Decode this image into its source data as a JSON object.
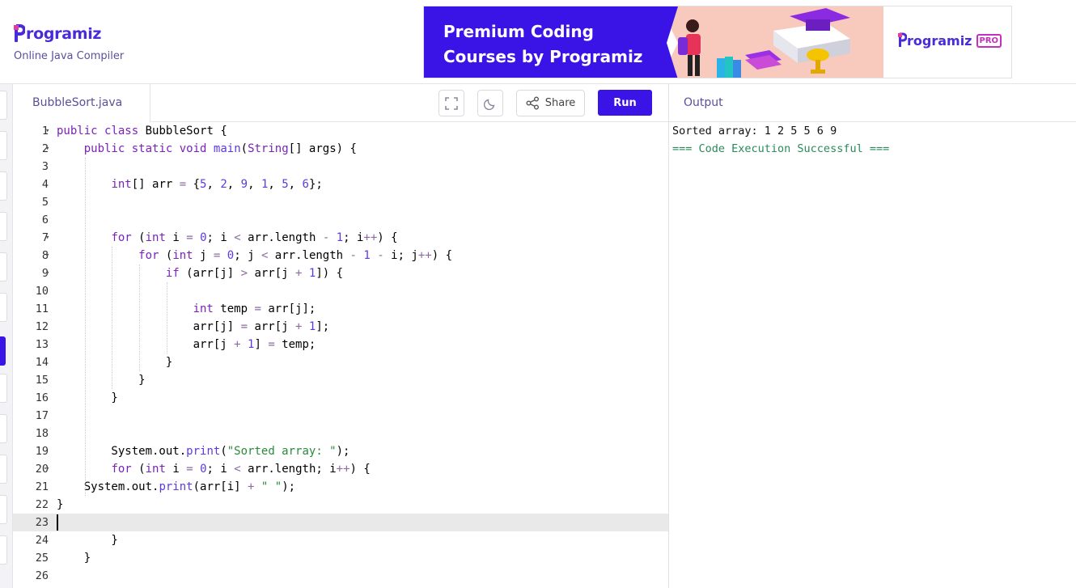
{
  "header": {
    "logo_text": "rogramiz",
    "subtitle": "Online Java Compiler"
  },
  "banner": {
    "title_line1": "Premium Coding",
    "title_line2": "Courses by Programiz",
    "pro_logo_text": "rogramiz",
    "pro_badge": "PRO",
    "accent_color": "#3a13e6"
  },
  "editor": {
    "file_name": "BubbleSort.java",
    "fullscreen_icon": "fullscreen-icon",
    "theme_icon": "moon-icon",
    "share_label": "Share",
    "run_label": "Run",
    "active_line": 23,
    "lines": [
      "public class BubbleSort {",
      "    public static void main(String[] args) {",
      "",
      "        int[] arr = {5, 2, 9, 1, 5, 6};",
      "",
      "",
      "        for (int i = 0; i < arr.length - 1; i++) {",
      "            for (int j = 0; j < arr.length - 1 - i; j++) {",
      "                if (arr[j] > arr[j + 1]) {",
      "",
      "                    int temp = arr[j];",
      "                    arr[j] = arr[j + 1];",
      "                    arr[j + 1] = temp;",
      "                }",
      "            }",
      "        }",
      "",
      "",
      "        System.out.print(\"Sorted array: \");",
      "        for (int i = 0; i < arr.length; i++) {",
      "    System.out.print(arr[i] + \" \");",
      "}",
      "",
      "        }",
      "    }",
      ""
    ],
    "fold_lines": [
      1,
      2,
      7,
      8,
      9,
      20
    ]
  },
  "output": {
    "title": "Output",
    "line1": "Sorted array: 1 2 5 5 6 9",
    "line2": "=== Code Execution Successful ==="
  }
}
